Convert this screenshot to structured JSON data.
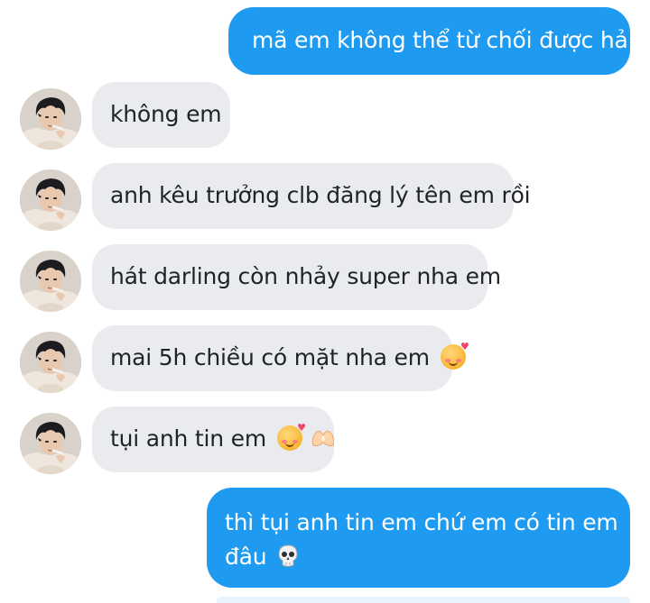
{
  "messages": [
    {
      "side": "out",
      "text": "mã em không thể từ chối được hả..."
    },
    {
      "side": "in",
      "text": "không em"
    },
    {
      "side": "in",
      "text": "anh kêu trưởng clb đăng lý tên em rồi"
    },
    {
      "side": "in",
      "text": "hát darling còn nhảy super nha em"
    },
    {
      "side": "in",
      "text": "mai 5h chiều có mặt nha em",
      "emoji": "smiling-face-with-hearts-icon"
    },
    {
      "side": "in",
      "text": "tụi anh tin em",
      "emoji": [
        "smiling-face-with-hearts-icon",
        "heart-hands-icon"
      ]
    },
    {
      "side": "out",
      "line1": "thì tụi anh tin em chứ em có tin em",
      "line2": "đâu",
      "emoji": "skull-icon"
    }
  ],
  "colors": {
    "outgoing_bubble": "#1e9bf0",
    "incoming_bubble": "#eaebee",
    "incoming_text": "#1f2328"
  }
}
